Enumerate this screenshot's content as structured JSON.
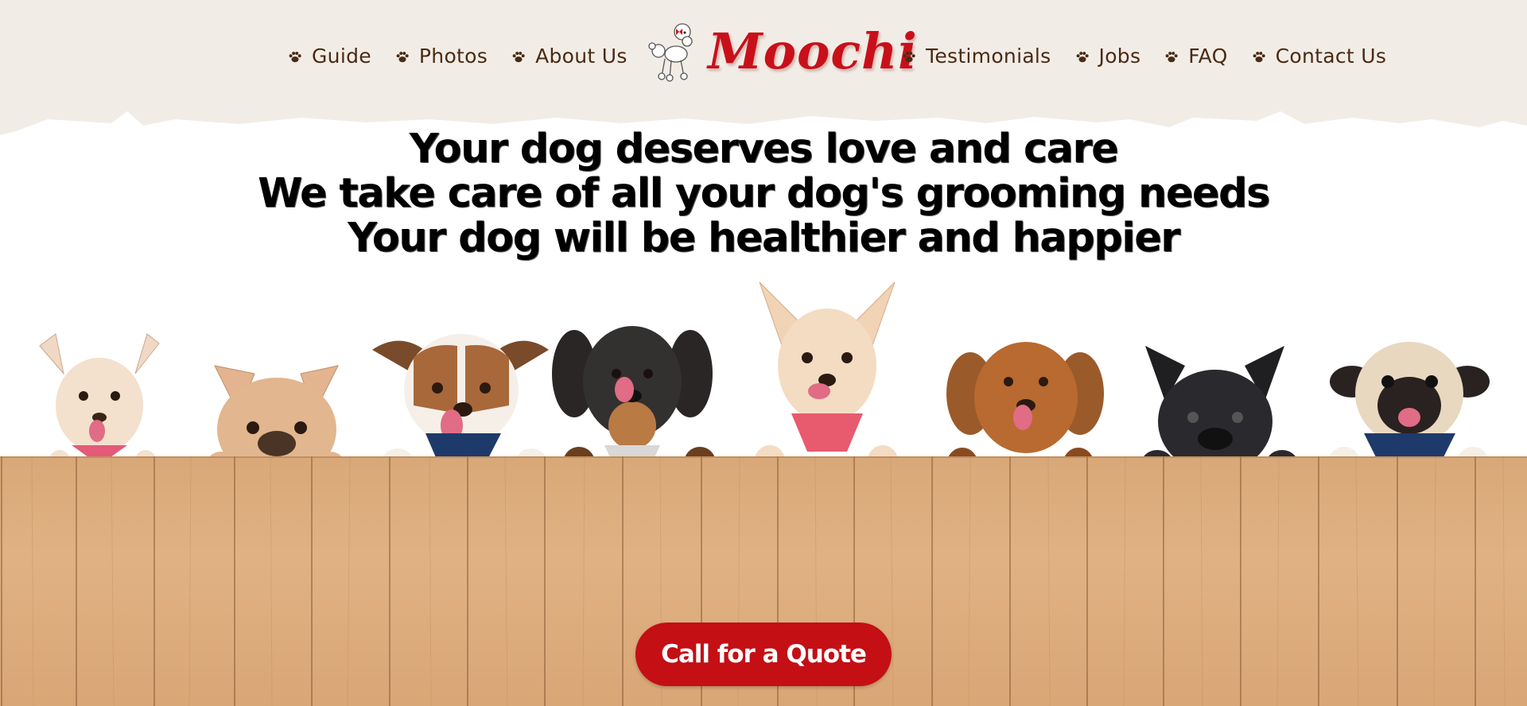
{
  "brand": {
    "name": "Moochi",
    "logo_icon": "poodle-icon",
    "color": "#c8101a"
  },
  "nav": {
    "left": [
      {
        "label": "Guide",
        "icon": "paw-icon"
      },
      {
        "label": "Photos",
        "icon": "paw-icon"
      },
      {
        "label": "About Us",
        "icon": "paw-icon"
      }
    ],
    "right": [
      {
        "label": "Testimonials",
        "icon": "paw-icon"
      },
      {
        "label": "Jobs",
        "icon": "paw-icon"
      },
      {
        "label": "FAQ",
        "icon": "paw-icon"
      },
      {
        "label": "Contact Us",
        "icon": "paw-icon"
      }
    ]
  },
  "hero": {
    "lines": [
      "Your dog deserves love and care",
      "We take care of all your dog's grooming needs",
      "Your dog will be healthier and happier"
    ],
    "image": "dogs-peeking-over-wooden-fence"
  },
  "cta": {
    "label": "Call for a Quote",
    "color": "#c40f15"
  },
  "colors": {
    "header_bg": "#f1ede6",
    "nav_text": "#4a2a14",
    "fence": "#d9a877"
  }
}
